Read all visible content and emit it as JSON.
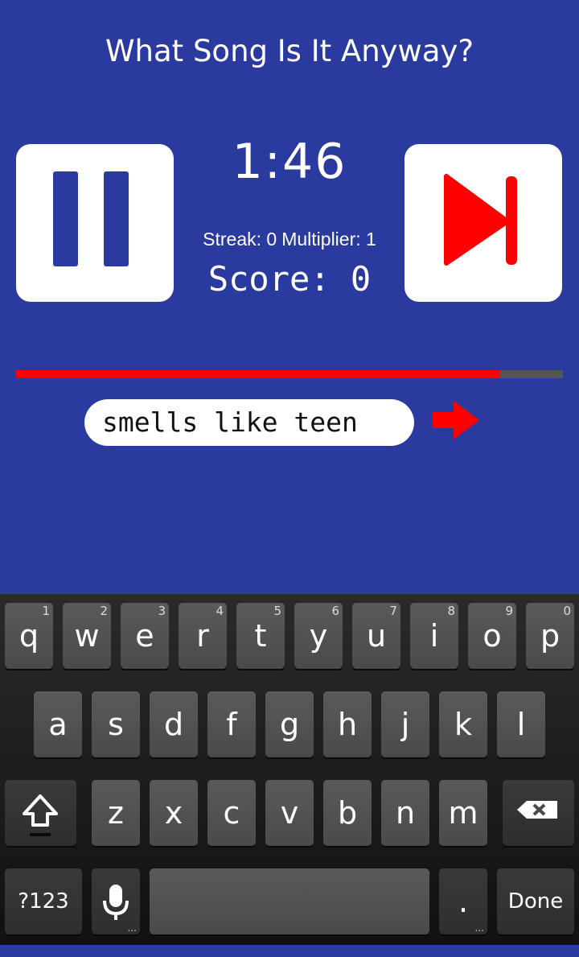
{
  "app": {
    "title": "What Song Is It Anyway?",
    "timer": "1:46",
    "streak_label": "Streak: 0",
    "multiplier_label": "Multiplier: 1",
    "score_label": "Score: 0",
    "progress_fraction": 0.885,
    "guess_input_value": "smells like teen",
    "colors": {
      "background": "#2a3a9e",
      "accent": "#ff0000",
      "pause_icon": "#2a3a9e",
      "progress_track": "#555555"
    },
    "icons": {
      "pause": "pause-icon",
      "skip": "skip-next-icon",
      "submit": "arrow-right-icon"
    }
  },
  "keyboard": {
    "row1": [
      {
        "key": "q",
        "hint": "1"
      },
      {
        "key": "w",
        "hint": "2"
      },
      {
        "key": "e",
        "hint": "3"
      },
      {
        "key": "r",
        "hint": "4"
      },
      {
        "key": "t",
        "hint": "5"
      },
      {
        "key": "y",
        "hint": "6"
      },
      {
        "key": "u",
        "hint": "7"
      },
      {
        "key": "i",
        "hint": "8"
      },
      {
        "key": "o",
        "hint": "9"
      },
      {
        "key": "p",
        "hint": "0"
      }
    ],
    "row2": [
      "a",
      "s",
      "d",
      "f",
      "g",
      "h",
      "j",
      "k",
      "l"
    ],
    "row3": [
      "z",
      "x",
      "c",
      "v",
      "b",
      "n",
      "m"
    ],
    "symbols_label": "?123",
    "period_label": ".",
    "done_label": "Done",
    "more_indicator": "...",
    "icons": {
      "shift": "shift-icon",
      "backspace": "backspace-icon",
      "mic": "microphone-icon"
    }
  }
}
